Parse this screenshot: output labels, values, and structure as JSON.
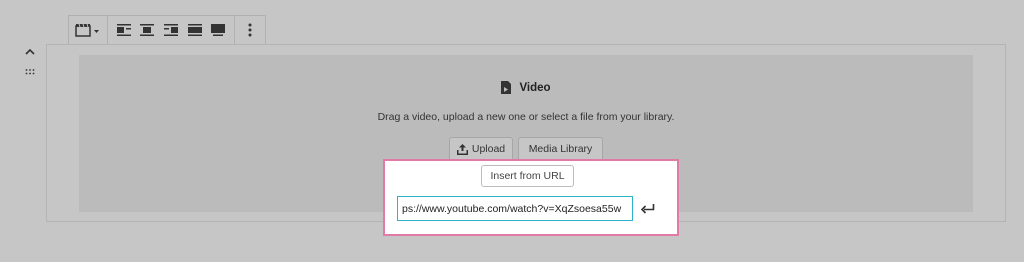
{
  "toolbar": {
    "video_icon": "clapper-icon",
    "align_icons": [
      "align-left-icon",
      "align-center-icon",
      "align-right-icon",
      "wide-width-icon",
      "full-width-icon"
    ],
    "more_icon": "more-vertical-icon"
  },
  "block": {
    "title": "Video",
    "instructions": "Drag a video, upload a new one or select a file from your library.",
    "upload_label": "Upload",
    "media_library_label": "Media Library"
  },
  "url_popover": {
    "insert_label": "Insert from URL",
    "url_value": "ps://www.youtube.com/watch?v=XqZsoesa55w",
    "accent_color": "#e07ba6",
    "input_focus_color": "#2bb3c9"
  }
}
